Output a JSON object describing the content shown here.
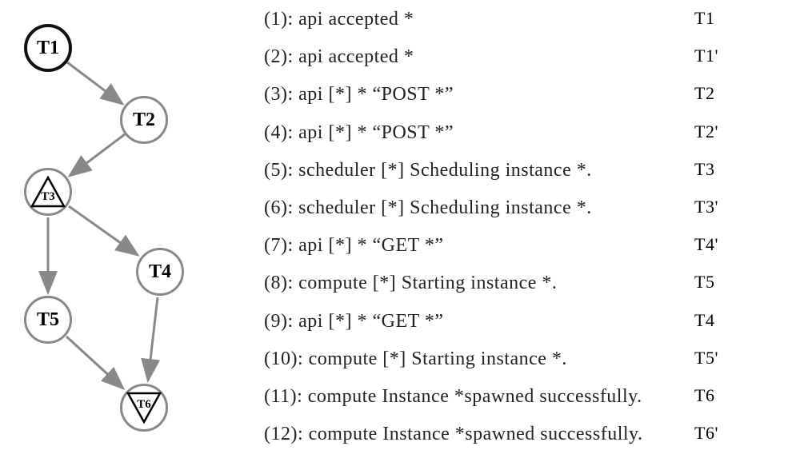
{
  "graph": {
    "nodes": {
      "t1": "T1",
      "t2": "T2",
      "t3": "T3",
      "t4": "T4",
      "t5": "T5",
      "t6": "T6"
    }
  },
  "log_entries": [
    {
      "line": "(1): api accepted *",
      "tag": "T1"
    },
    {
      "line": "(2): api accepted *",
      "tag": "T1'"
    },
    {
      "line": "(3): api [*] * “POST *”",
      "tag": "T2"
    },
    {
      "line": "(4): api [*] * “POST *”",
      "tag": "T2'"
    },
    {
      "line": "(5): scheduler [*] Scheduling instance *.",
      "tag": "T3"
    },
    {
      "line": "(6): scheduler [*] Scheduling instance *.",
      "tag": "T3'"
    },
    {
      "line": "(7): api [*] * “GET *”",
      "tag": "T4'"
    },
    {
      "line": "(8): compute [*] Starting instance *.",
      "tag": "T5"
    },
    {
      "line": "(9): api [*] * “GET *”",
      "tag": "T4"
    },
    {
      "line": "(10): compute [*] Starting instance *.",
      "tag": "T5'"
    },
    {
      "line": "(11): compute Instance *spawned successfully.",
      "tag": "T6"
    },
    {
      "line": "(12): compute Instance *spawned successfully.",
      "tag": "T6'"
    }
  ],
  "chart_data": {
    "type": "diagram",
    "graph_type": "directed",
    "nodes": [
      "T1",
      "T2",
      "T3",
      "T4",
      "T5",
      "T6"
    ],
    "edges": [
      [
        "T1",
        "T2"
      ],
      [
        "T2",
        "T3"
      ],
      [
        "T3",
        "T4"
      ],
      [
        "T3",
        "T5"
      ],
      [
        "T4",
        "T6"
      ],
      [
        "T5",
        "T6"
      ]
    ],
    "node_markers": {
      "T3": "triangle-up",
      "T6": "triangle-down"
    }
  }
}
